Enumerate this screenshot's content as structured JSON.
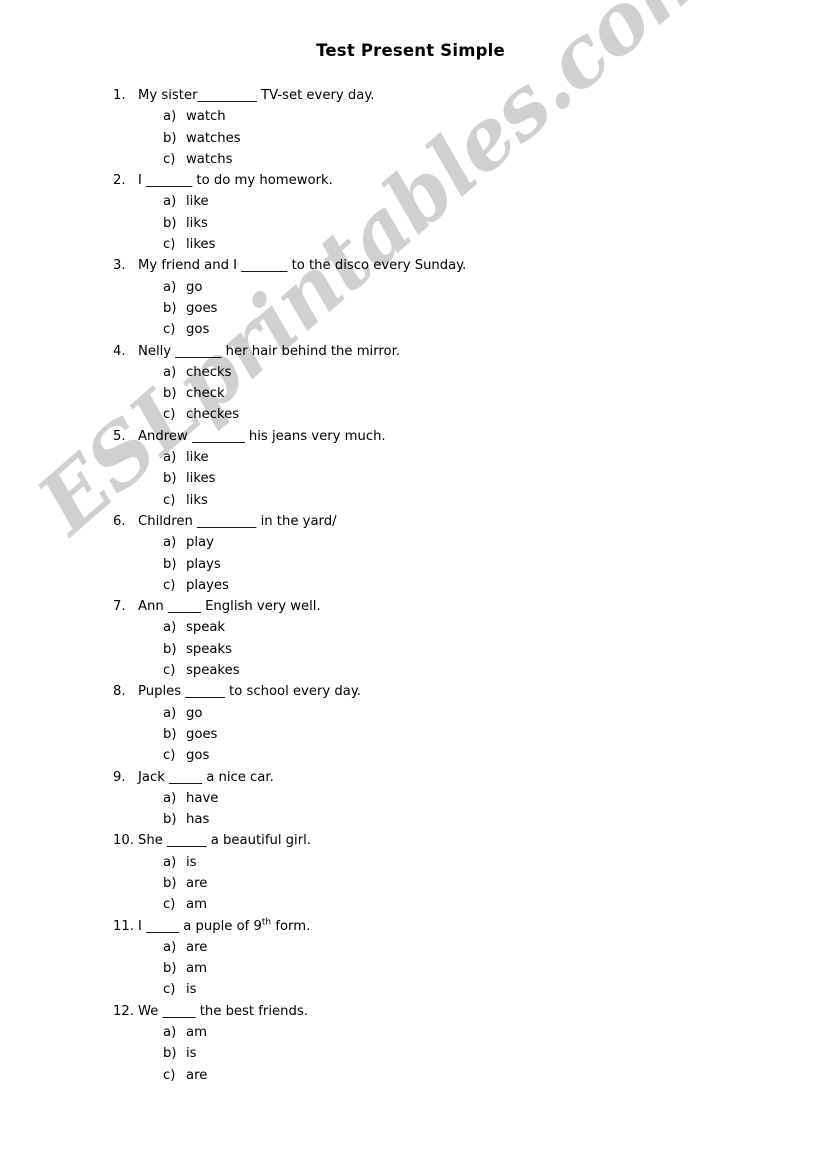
{
  "document": {
    "title": "Test Present Simple",
    "watermark": "ESLprintables.com",
    "watermark_color": "#d0d0d0",
    "text_color": "#000000",
    "background_color": "#ffffff"
  },
  "questions": [
    {
      "number": "1.",
      "prompt": "My sister_________ TV-set every day.",
      "options": [
        {
          "letter": "a)",
          "text": "watch"
        },
        {
          "letter": "b)",
          "text": "watches"
        },
        {
          "letter": "c)",
          "text": "watchs"
        }
      ]
    },
    {
      "number": "2.",
      "prompt": "I _______ to do my homework.",
      "options": [
        {
          "letter": "a)",
          "text": "like"
        },
        {
          "letter": "b)",
          "text": "liks"
        },
        {
          "letter": "c)",
          "text": "likes"
        }
      ]
    },
    {
      "number": "3.",
      "prompt": "My friend and I _______ to the disco every Sunday.",
      "options": [
        {
          "letter": "a)",
          "text": "go"
        },
        {
          "letter": "b)",
          "text": "goes"
        },
        {
          "letter": "c)",
          "text": "gos"
        }
      ]
    },
    {
      "number": "4.",
      "prompt": "Nelly _______ her hair behind the mirror.",
      "options": [
        {
          "letter": "a)",
          "text": "checks"
        },
        {
          "letter": "b)",
          "text": "check"
        },
        {
          "letter": "c)",
          "text": "checkes"
        }
      ]
    },
    {
      "number": "5.",
      "prompt": "Andrew ________ his jeans very much.",
      "options": [
        {
          "letter": "a)",
          "text": "like"
        },
        {
          "letter": "b)",
          "text": "likes"
        },
        {
          "letter": "c)",
          "text": "liks"
        }
      ]
    },
    {
      "number": "6.",
      "prompt": "Children _________ in the yard/",
      "options": [
        {
          "letter": "a)",
          "text": "play"
        },
        {
          "letter": "b)",
          "text": "plays"
        },
        {
          "letter": "c)",
          "text": "playes"
        }
      ]
    },
    {
      "number": "7.",
      "prompt": "Ann _____ English very well.",
      "options": [
        {
          "letter": "a)",
          "text": "speak"
        },
        {
          "letter": "b)",
          "text": "speaks"
        },
        {
          "letter": "c)",
          "text": "speakes"
        }
      ]
    },
    {
      "number": "8.",
      "prompt": "Puples ______ to school every day.",
      "options": [
        {
          "letter": "a)",
          "text": "go"
        },
        {
          "letter": "b)",
          "text": "goes"
        },
        {
          "letter": "c)",
          "text": "gos"
        }
      ]
    },
    {
      "number": "9.",
      "prompt": "Jack _____ a nice car.",
      "options": [
        {
          "letter": "a)",
          "text": "have"
        },
        {
          "letter": "b)",
          "text": "has"
        }
      ]
    },
    {
      "number": "10.",
      "prompt": "She ______ a beautiful girl.",
      "options": [
        {
          "letter": "a)",
          "text": "is"
        },
        {
          "letter": "b)",
          "text": "are"
        },
        {
          "letter": "c)",
          "text": "am"
        }
      ]
    },
    {
      "number": "11.",
      "prompt_pre": "I _____ a puple of 9",
      "prompt_sup": "th",
      "prompt_post": " form.",
      "options": [
        {
          "letter": "a)",
          "text": "are"
        },
        {
          "letter": "b)",
          "text": "am"
        },
        {
          "letter": "c)",
          "text": "is"
        }
      ]
    },
    {
      "number": "12.",
      "prompt": "We _____ the best friends.",
      "options": [
        {
          "letter": "a)",
          "text": "am"
        },
        {
          "letter": "b)",
          "text": "is"
        },
        {
          "letter": "c)",
          "text": "are"
        }
      ]
    }
  ]
}
